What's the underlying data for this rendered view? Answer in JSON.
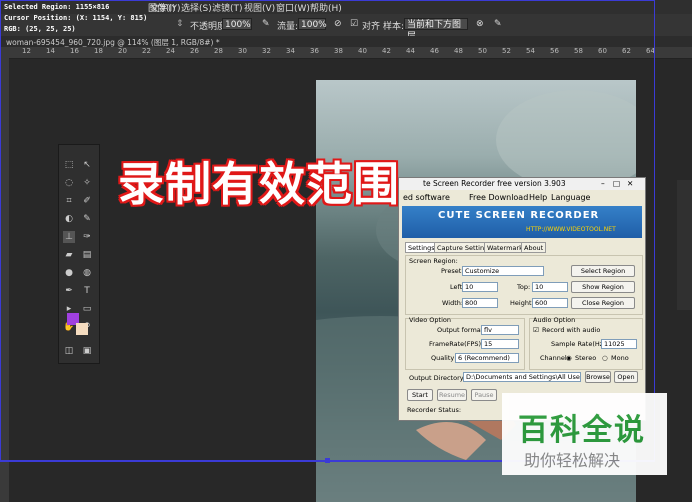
{
  "window": {
    "menu": [
      "图像(I)",
      "文字(Y)",
      "选择(S)",
      "滤镜(T)",
      "视图(V)",
      "窗口(W)",
      "帮助(H)"
    ],
    "doc_tab": "woman-695454_960_720.jpg @ 114% (图层 1, RGB/8#) *"
  },
  "options": {
    "opacity_label": "不透明度:",
    "opacity_value": "100%",
    "flow_label": "流量:",
    "flow_value": "100%",
    "align_label": "对齐",
    "sample_label": "样本:",
    "sample_value": "当前和下方图层"
  },
  "ruler": {
    "ticks": [
      "12",
      "14",
      "16",
      "18",
      "20",
      "22",
      "24",
      "26",
      "28",
      "30",
      "32",
      "34",
      "36",
      "38",
      "40",
      "42",
      "44",
      "46",
      "48",
      "50",
      "52",
      "54",
      "56",
      "58",
      "60",
      "62",
      "64"
    ]
  },
  "region_info": {
    "line1": "Selected Region: 1155×816",
    "line2": "Cursor Position: (X: 1154, Y: 815)",
    "line3": "RGB: (25, 25, 25)"
  },
  "overlay_title": "录制有效范围",
  "recorder": {
    "title": "te Screen Recorder free version 3.903",
    "menu": [
      "ed software",
      "Free Download",
      "Help",
      "Language"
    ],
    "banner_title": "CUTE SCREEN RECORDER",
    "banner_url": "HTTP://WWW.VIDEOTOOL.NET",
    "tabs": [
      "Settings",
      "Capture Settings",
      "Watermark",
      "About"
    ],
    "screen_region_label": "Screen Region:",
    "preset_label": "Preset:",
    "preset_value": "Customize",
    "left_label": "Left:",
    "left_value": "10",
    "top_label": "Top:",
    "top_value": "10",
    "width_label": "Width:",
    "width_value": "800",
    "height_label": "Height:",
    "height_value": "600",
    "select_region": "Select Region",
    "show_region": "Show Region",
    "close_region": "Close Region",
    "video_option_label": "Video Option",
    "output_format_label": "Output format:",
    "output_format_value": "flv",
    "framerate_label": "FrameRate(FPS):",
    "framerate_value": "15",
    "quality_label": "Quality",
    "quality_value": "6 (Recommend)",
    "audio_option_label": "Audio Option",
    "record_audio_label": "Record with audio",
    "sample_rate_label": "Sample Rate(Hz):",
    "sample_rate_value": "11025",
    "channel_label": "Channel:",
    "stereo_label": "Stereo",
    "mono_label": "Mono",
    "output_dir_label": "Output Directory:",
    "output_dir_value": "D:\\Documents and Settings\\All Users\\scre",
    "browse": "Browse",
    "open": "Open",
    "start": "Start",
    "resume": "Resume",
    "pause": "Pause",
    "status_label": "Recorder Status:"
  },
  "watermark": {
    "title": "百科全说",
    "subtitle": "助你轻松解决"
  },
  "colors": {
    "overlay_border": "#3b3bd6",
    "title_red": "#e01818",
    "banner_blue": "#2a6fb8",
    "fg_swatch": "#a040e0",
    "bg_swatch": "#f5dcc0",
    "watermark_green": "#2a9a3a"
  }
}
